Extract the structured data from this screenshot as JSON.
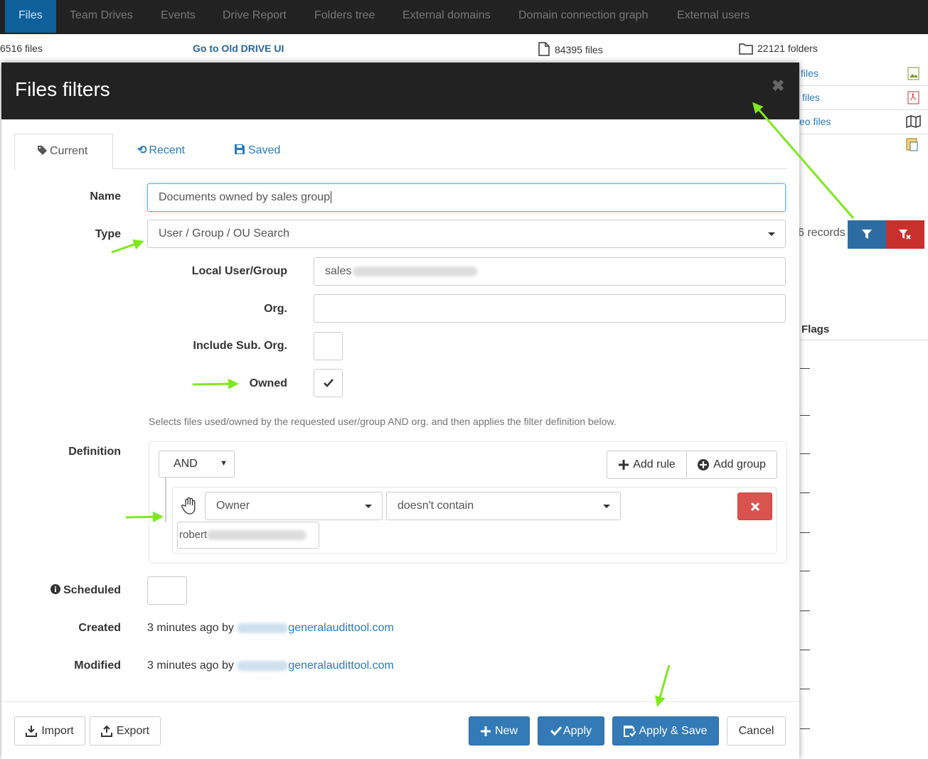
{
  "topnav": {
    "tabs": [
      "Files",
      "Team Drives",
      "Events",
      "Drive Report",
      "Folders tree",
      "External domains",
      "Domain connection graph",
      "External users"
    ]
  },
  "background": {
    "files_count": "6516 files",
    "old_ui_link": "Go to Old DRIVE UI",
    "total_files": "84395 files",
    "folders": "22121 folders",
    "image_files": "files",
    "pdf_files": "files",
    "video_files": "eo files",
    "records": "6 records",
    "flags_header": "Flags",
    "dash": "—"
  },
  "modal": {
    "title": "Files filters",
    "tabs": {
      "current": "Current",
      "recent": "Recent",
      "saved": "Saved"
    },
    "name_label": "Name",
    "name_value": "Documents owned by sales group",
    "type_label": "Type",
    "type_value": "User / Group / OU Search",
    "local_user_label": "Local User/Group",
    "local_user_value": "sales",
    "org_label": "Org.",
    "org_value": "",
    "include_sub_label": "Include Sub. Org.",
    "owned_label": "Owned",
    "owned_checked": true,
    "help_text": "Selects files used/owned by the requested user/group AND org. and then applies the filter definition below.",
    "definition_label": "Definition",
    "definition": {
      "condition": "AND",
      "add_rule": "Add rule",
      "add_group": "Add group",
      "rule_field": "Owner",
      "rule_operator": "doesn't contain",
      "rule_value": "robert"
    },
    "scheduled_label": "Scheduled",
    "created_label": "Created",
    "created_value": "3 minutes ago by",
    "modified_label": "Modified",
    "modified_value": "3 minutes ago by",
    "email_domain": "generalaudittool.com",
    "buttons": {
      "import": "Import",
      "export": "Export",
      "new": "New",
      "apply": "Apply",
      "apply_save": "Apply & Save",
      "cancel": "Cancel"
    }
  },
  "colors": {
    "primary": "#337ab7",
    "danger": "#d9534f",
    "arrow": "#7ee81e",
    "header": "#222222"
  }
}
